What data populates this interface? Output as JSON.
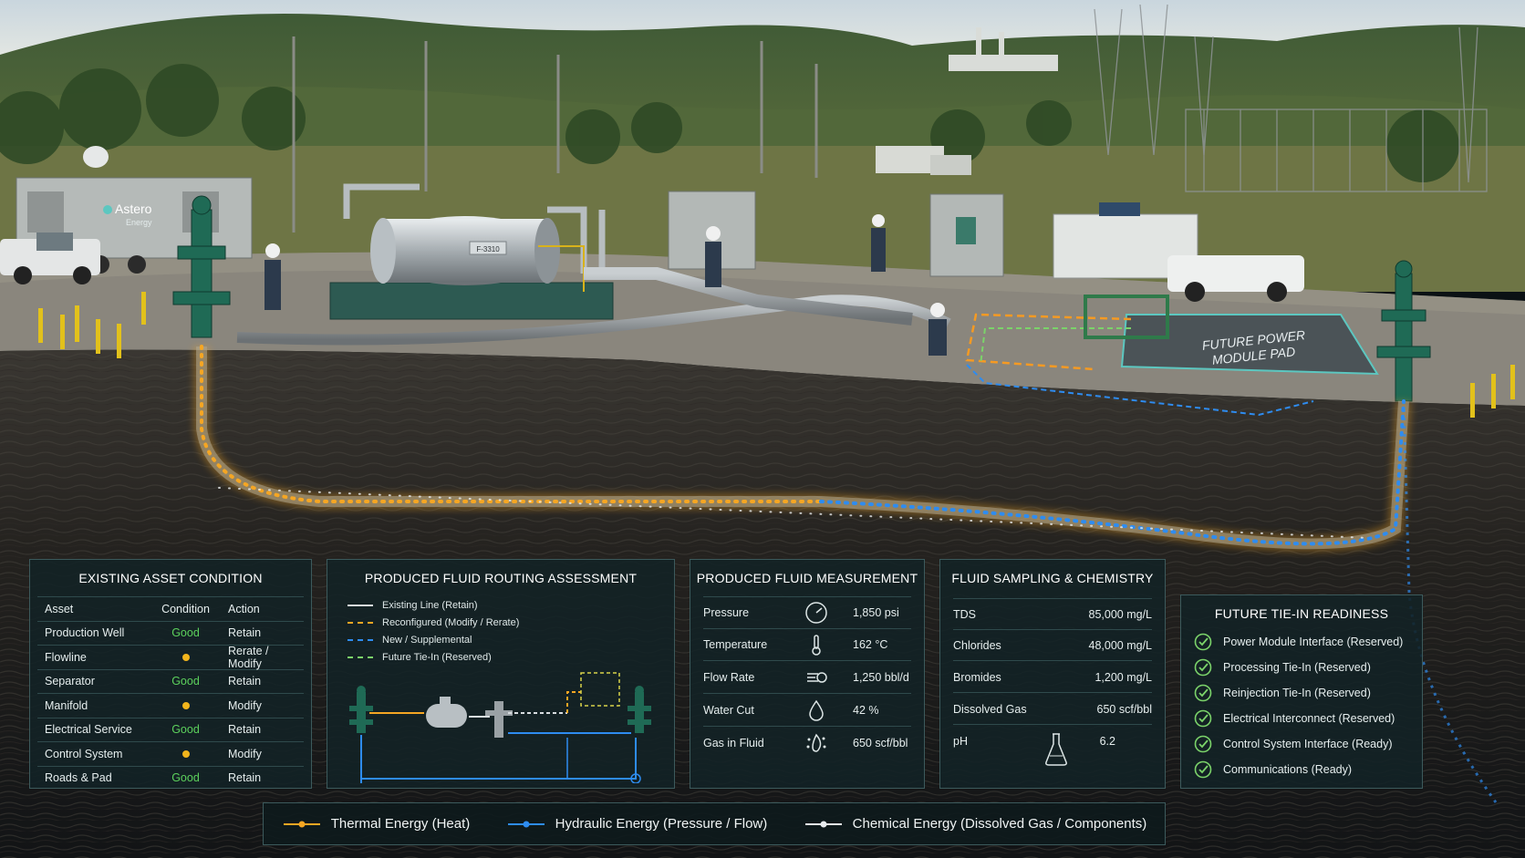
{
  "colors": {
    "thermal": "#f5a623",
    "hydraulic": "#2e8cf0",
    "chemical": "#e8ecef",
    "good": "#5cd15c",
    "warn": "#f2b51c",
    "tiein": "#7bd36a"
  },
  "scene": {
    "trailer_brand": "Astero",
    "trailer_brand_sub": "Energy",
    "tank_label": "F-3310",
    "pad_label_line1": "FUTURE POWER",
    "pad_label_line2": "MODULE PAD"
  },
  "asset_condition": {
    "title": "EXISTING ASSET CONDITION",
    "headers": [
      "Asset",
      "Condition",
      "Action"
    ],
    "rows": [
      {
        "asset": "Production Well",
        "condition": "Good",
        "action": "Retain"
      },
      {
        "asset": "Flowline",
        "condition": "",
        "action": "Rerate / Modify"
      },
      {
        "asset": "Separator",
        "condition": "Good",
        "action": "Retain"
      },
      {
        "asset": "Manifold",
        "condition": "",
        "action": "Modify"
      },
      {
        "asset": "Electrical Service",
        "condition": "Good",
        "action": "Retain"
      },
      {
        "asset": "Control System",
        "condition": "",
        "action": "Modify"
      },
      {
        "asset": "Roads & Pad",
        "condition": "Good",
        "action": "Retain"
      }
    ]
  },
  "routing": {
    "title": "PRODUCED FLUID ROUTING ASSESSMENT",
    "legend": [
      "Existing Line (Retain)",
      "Reconfigured (Modify / Rerate)",
      "New / Supplemental",
      "Future Tie-In (Reserved)"
    ]
  },
  "measurement": {
    "title": "PRODUCED FLUID MEASUREMENT",
    "rows": [
      {
        "label": "Pressure",
        "icon": "gauge-icon",
        "value": "1,850 psi"
      },
      {
        "label": "Temperature",
        "icon": "thermometer-icon",
        "value": "162 °C"
      },
      {
        "label": "Flow Rate",
        "icon": "flow-icon",
        "value": "1,250 bbl/d"
      },
      {
        "label": "Water Cut",
        "icon": "droplet-icon",
        "value": "42 %"
      },
      {
        "label": "Gas in Fluid",
        "icon": "gas-icon",
        "value": "650 scf/bbl"
      }
    ]
  },
  "chemistry": {
    "title": "FLUID SAMPLING & CHEMISTRY",
    "rows": [
      {
        "label": "TDS",
        "value": "85,000 mg/L"
      },
      {
        "label": "Chlorides",
        "value": "48,000 mg/L"
      },
      {
        "label": "Bromides",
        "value": "1,200 mg/L"
      },
      {
        "label": "Dissolved Gas",
        "value": "650 scf/bbl"
      },
      {
        "label": "pH",
        "value": "6.2"
      }
    ]
  },
  "tiein": {
    "title": "FUTURE TIE-IN READINESS",
    "items": [
      "Power Module Interface (Reserved)",
      "Processing Tie-In (Reserved)",
      "Reinjection Tie-In (Reserved)",
      "Electrical Interconnect (Reserved)",
      "Control System Interface (Ready)",
      "Communications (Ready)"
    ]
  },
  "energy_legend": {
    "thermal": "Thermal Energy (Heat)",
    "hydraulic": "Hydraulic Energy (Pressure / Flow)",
    "chemical": "Chemical Energy (Dissolved Gas / Components)"
  }
}
